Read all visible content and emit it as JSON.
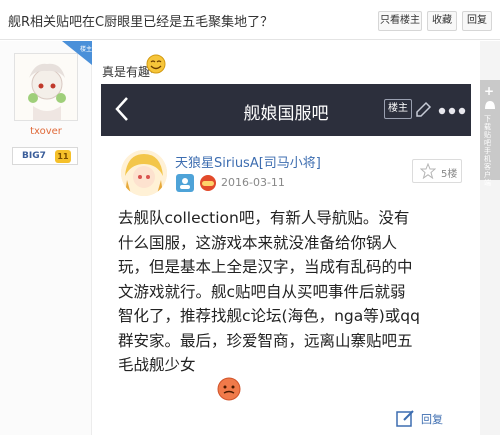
{
  "header": {
    "title": "舰R相关贴吧在C厨眼里已经是五毛聚集地了？",
    "buttons": [
      "只看楼主",
      "收藏",
      "回复"
    ]
  },
  "author": {
    "badge": "楼主",
    "username": "txover",
    "level_name": "BIG7",
    "level_num": "11"
  },
  "post": {
    "intro": "真是有趣~",
    "screenshot": {
      "bar_title": "舰娘国服吧",
      "lz_label": "楼主",
      "poster_name": "天狼星SiriusA[司马小将]",
      "date": "2016-03-11",
      "floor": "5楼",
      "body_lines": [
        "去舰队collection吧，有新人导航贴。没有",
        "什么国服，这游戏本来就没准备给你锅人",
        "玩，但是基本上全是汉字，当成有乱码的中",
        "文游戏就行。舰c贴吧自从买吧事件后就弱",
        "智化了，推荐找舰c论坛(海色，nga等)或qq",
        "群安家。最后，珍爱智商，远离山寨贴吧五",
        "毛战舰少女"
      ],
      "reply_label": "回复"
    }
  },
  "side_tool": {
    "text": "下载贴吧手机客户端"
  }
}
